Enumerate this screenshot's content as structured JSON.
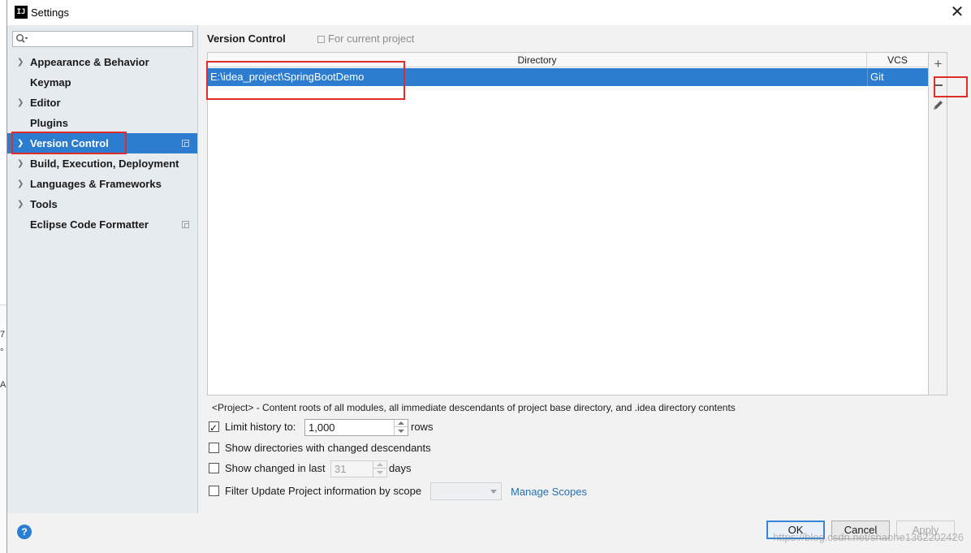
{
  "window": {
    "app_icon_text": "IJ",
    "title": "Settings",
    "close_glyph": "✕"
  },
  "background_app": {
    "edge_chars": [
      "7",
      "°",
      "Al"
    ]
  },
  "sidebar": {
    "search": {
      "value": "",
      "placeholder": "",
      "icon": "search-icon"
    },
    "items": [
      {
        "label": "Appearance & Behavior",
        "expandable": true,
        "selected": false,
        "project_scope_icon": false
      },
      {
        "label": "Keymap",
        "expandable": false,
        "selected": false,
        "project_scope_icon": false
      },
      {
        "label": "Editor",
        "expandable": true,
        "selected": false,
        "project_scope_icon": false
      },
      {
        "label": "Plugins",
        "expandable": false,
        "selected": false,
        "project_scope_icon": false
      },
      {
        "label": "Version Control",
        "expandable": true,
        "selected": true,
        "project_scope_icon": true
      },
      {
        "label": "Build, Execution, Deployment",
        "expandable": true,
        "selected": false,
        "project_scope_icon": false
      },
      {
        "label": "Languages & Frameworks",
        "expandable": true,
        "selected": false,
        "project_scope_icon": false
      },
      {
        "label": "Tools",
        "expandable": true,
        "selected": false,
        "project_scope_icon": false
      },
      {
        "label": "Eclipse Code Formatter",
        "expandable": false,
        "selected": false,
        "project_scope_icon": true
      }
    ]
  },
  "content": {
    "title": "Version Control",
    "scope_hint": "For current project",
    "table": {
      "columns": [
        "Directory",
        "VCS"
      ],
      "rows": [
        {
          "directory": "E:\\idea_project\\SpringBootDemo",
          "vcs": "Git",
          "selected": true
        }
      ]
    },
    "toolbar": {
      "add_glyph": "+",
      "remove_label": "remove",
      "edit_label": "edit"
    },
    "note": "<Project> - Content roots of all modules, all immediate descendants of project base directory, and .idea directory contents",
    "options": {
      "limit_history": {
        "label": "Limit history to:",
        "checked": true,
        "value": "1,000",
        "suffix": "rows"
      },
      "show_dirs": {
        "label": "Show directories with changed descendants",
        "checked": false
      },
      "show_changed": {
        "label": "Show changed in last",
        "checked": false,
        "value": "31",
        "suffix": "days"
      },
      "filter_update": {
        "label": "Filter Update Project information by scope",
        "checked": false,
        "scope_value": "",
        "link": "Manage Scopes"
      }
    }
  },
  "footer": {
    "help_glyph": "?",
    "ok": "OK",
    "cancel": "Cancel",
    "apply": "Apply",
    "watermark": "https://blog.csdn.net/shaohe1362202426"
  },
  "colors": {
    "selection": "#2c7dcf",
    "annotation": "#e02b2b",
    "link": "#2470b3"
  }
}
